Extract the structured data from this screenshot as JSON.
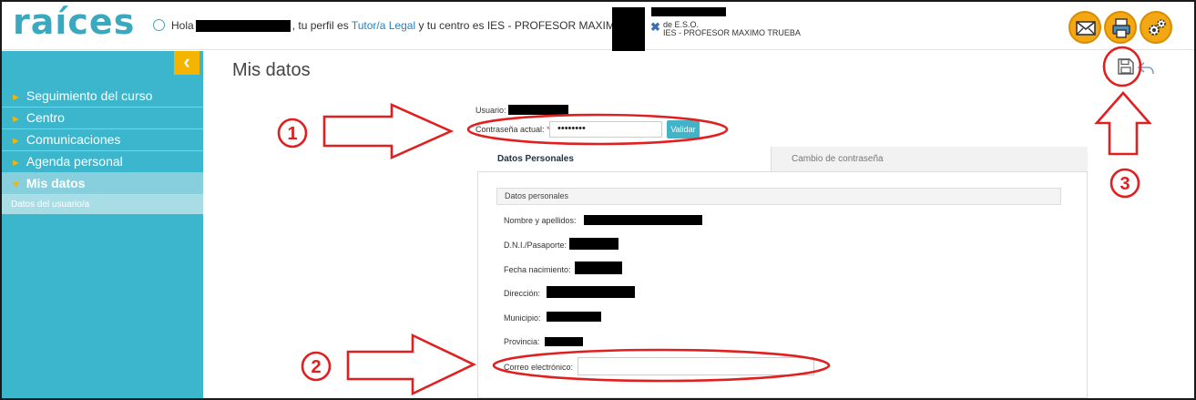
{
  "header": {
    "logo": "raíces",
    "greeting_prefix": "Hola",
    "greeting_mid": ", tu perfil es ",
    "profile": "Tutor/a Legal",
    "greeting_mid2": " y tu centro es ",
    "center": "IES - PROFESOR MAXIMO T",
    "center_line1": "de E.S.O.",
    "center_line2": "IES - PROFESOR MAXIMO TRUEBA",
    "icons": [
      "mail-icon",
      "print-icon",
      "settings-icon"
    ],
    "accent_color": "#f3a712"
  },
  "sidebar": {
    "collapse_glyph": "‹",
    "items": [
      {
        "label": "Seguimiento del curso"
      },
      {
        "label": "Centro"
      },
      {
        "label": "Comunicaciones"
      },
      {
        "label": "Agenda personal"
      },
      {
        "label": "Mis datos",
        "active": true
      }
    ],
    "subitem": "Datos del usuario/a",
    "color": "#3cb6cc"
  },
  "main": {
    "title": "Mis datos",
    "usuario_label": "Usuario:",
    "password_label": "Contraseña actual:",
    "password_required": "*",
    "password_value": "••••••••",
    "validate_button": "Validar",
    "tabs": [
      {
        "label": "Datos Personales",
        "active": true
      },
      {
        "label": "Cambio de contraseña",
        "active": false
      }
    ],
    "section_title": "Datos personales",
    "fields": {
      "nombre": "Nombre y apellidos:",
      "dni": "D.N.I./Pasaporte:",
      "fecha": "Fecha nacimiento:",
      "direccion": "Dirección:",
      "municipio": "Municipio:",
      "provincia": "Provincia:",
      "correo": "Correo electrónico:"
    },
    "email_value": ""
  },
  "annotations": {
    "n1": "1",
    "n2": "2",
    "n3": "3",
    "color": "#e02020"
  }
}
